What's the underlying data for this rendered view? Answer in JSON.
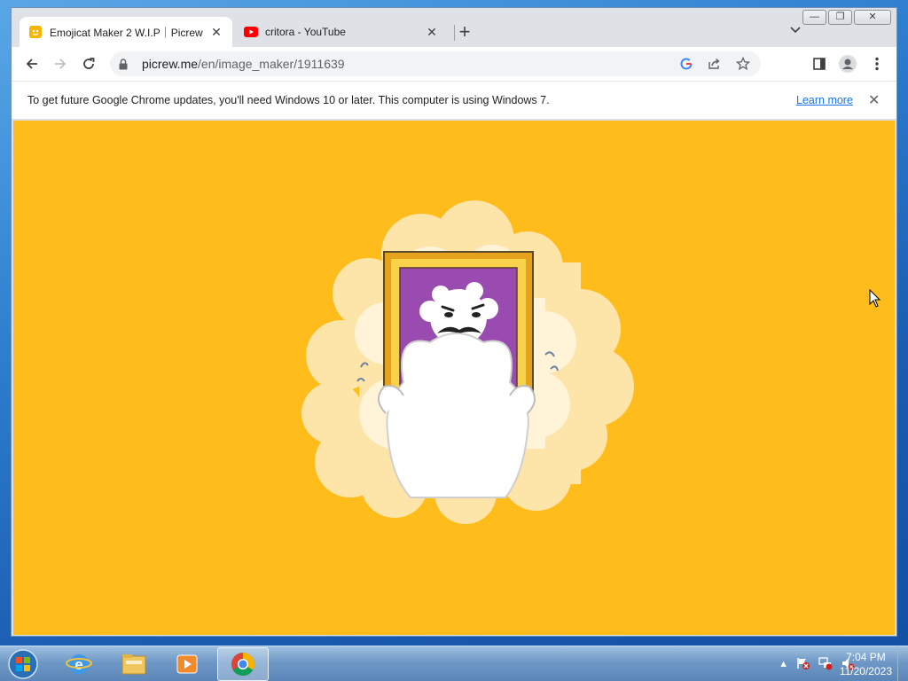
{
  "browser": {
    "tabs": [
      {
        "title": "Emojicat Maker 2 W.I.P｜Picrew",
        "favicon": "picrew-icon",
        "active": true
      },
      {
        "title": "critora - YouTube",
        "favicon": "youtube-icon",
        "active": false
      }
    ],
    "new_tab_label": "+",
    "window_controls": {
      "minimize": "—",
      "maximize": "❐",
      "close": "✕"
    },
    "address": {
      "host": "picrew.me",
      "path": "/en/image_maker/1911639"
    },
    "infobar": {
      "message": "To get future Google Chrome updates, you'll need Windows 10 or later. This computer is using Windows 7.",
      "link": "Learn more"
    }
  },
  "page": {
    "background_color": "#ffbc1b",
    "illustration": "loading-cat-with-portrait"
  },
  "taskbar": {
    "apps": [
      "internet-explorer-icon",
      "file-explorer-icon",
      "media-player-icon",
      "chrome-icon"
    ],
    "clock_time": "7:04 PM",
    "clock_date": "11/20/2023",
    "tray_arrow": "▲"
  }
}
